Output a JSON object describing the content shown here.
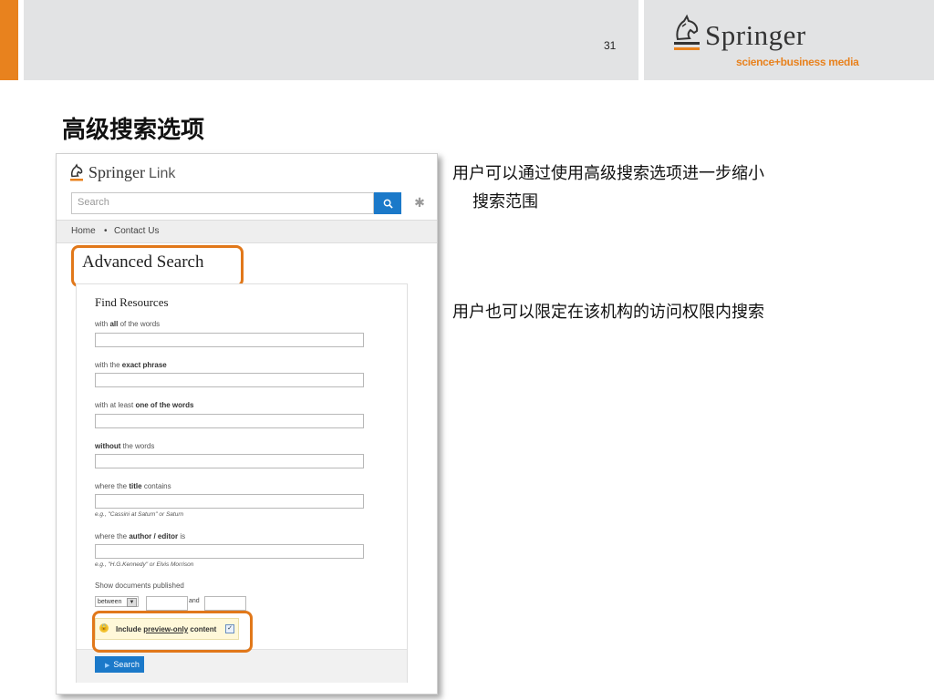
{
  "slide": {
    "page_number": "31",
    "title": "高级搜索选项",
    "bullets": [
      {
        "line1": "用户可以通过使用高级搜索选项进一步缩小",
        "line2": "搜索范围"
      },
      {
        "line1": "用户也可以限定在该机构的访问权限内搜索"
      }
    ]
  },
  "brand": {
    "name": "Springer",
    "tagline": "science+business media",
    "accent_color": "#e8821e"
  },
  "springerlink": {
    "logo_word": "Springer",
    "logo_link": "Link",
    "search_placeholder": "Search",
    "search_button_icon": "magnifier-icon",
    "settings_icon": "gear-icon",
    "nav": {
      "home": "Home",
      "separator": "•",
      "contact": "Contact Us"
    },
    "page_title": "Advanced Search",
    "form": {
      "title": "Find Resources",
      "fields": [
        {
          "pre": "with ",
          "bold": "all",
          "post": " of the words"
        },
        {
          "pre": "with the ",
          "bold": "exact phrase",
          "post": ""
        },
        {
          "pre": "with at least ",
          "bold": "one of the words",
          "post": ""
        },
        {
          "pre": "",
          "bold": "without",
          "post": " the words"
        },
        {
          "pre": "where the ",
          "bold": "title",
          "post": " contains",
          "hint": "e.g., \"Cassini at Saturn\" or Saturn"
        },
        {
          "pre": "where the ",
          "bold": "author / editor",
          "post": " is",
          "hint": "e.g., \"H.G.Kennedy\" or Elvis Morrison"
        }
      ],
      "date_label": "Show documents published",
      "date_mode": "between",
      "date_and": "and",
      "preview_pre": "Include ",
      "preview_link": "preview-only",
      "preview_post": " content",
      "preview_checked": true,
      "search_button": "Search",
      "highlight_color": "#e1781a"
    }
  }
}
